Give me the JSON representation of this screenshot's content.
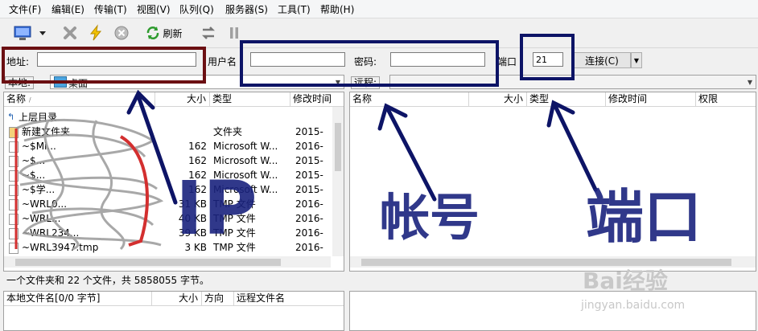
{
  "menu": [
    "文件(F)",
    "编辑(E)",
    "传输(T)",
    "视图(V)",
    "队列(Q)",
    "服务器(S)",
    "工具(T)",
    "帮助(H)"
  ],
  "toolbar": {
    "refresh_label": "刷新",
    "icons": [
      "site-manager-icon",
      "dropdown-arrow-icon",
      "disconnect-icon",
      "reconnect-icon",
      "cancel-icon",
      "refresh-icon",
      "compare-icon",
      "pause-icon"
    ]
  },
  "connection": {
    "host_label": "地址:",
    "host_value": "",
    "user_label": "用户名",
    "user_value": "",
    "pass_label": "密码:",
    "pass_value": "",
    "port_label": "端口",
    "port_value": "21",
    "connect_label": "连接(C)"
  },
  "local": {
    "path_label": "本地:",
    "path_value": "桌面",
    "columns": [
      "名称",
      "大小",
      "类型",
      "修改时间"
    ],
    "parent_dir": "上层目录",
    "rows": [
      {
        "name": "新建文件夹",
        "size": "",
        "type": "文件夹",
        "date": "2015-"
      },
      {
        "name": "~$Mi...",
        "size": "162",
        "type": "Microsoft W...",
        "date": "2016-"
      },
      {
        "name": "~$...",
        "size": "162",
        "type": "Microsoft W...",
        "date": "2015-"
      },
      {
        "name": "~$...",
        "size": "162",
        "type": "Microsoft W...",
        "date": "2015-"
      },
      {
        "name": "~$学...",
        "size": "162",
        "type": "Microsoft W...",
        "date": "2015-"
      },
      {
        "name": "~WRL0...",
        "size": "31 KB",
        "type": "TMP 文件",
        "date": "2016-"
      },
      {
        "name": "~WRL...",
        "size": "40 KB",
        "type": "TMP 文件",
        "date": "2016-"
      },
      {
        "name": "~WRL234...",
        "size": "39 KB",
        "type": "TMP 文件",
        "date": "2016-"
      },
      {
        "name": "~WRL3947.tmp",
        "size": "3 KB",
        "type": "TMP 文件",
        "date": "2016-"
      }
    ],
    "status": "一个文件夹和 22 个文件，共 5858055 字节。"
  },
  "remote": {
    "path_label": "远程:",
    "path_value": "",
    "columns": [
      "名称",
      "大小",
      "类型",
      "修改时间",
      "权限"
    ]
  },
  "queue": {
    "columns": [
      "本地文件名[0/0 字节]",
      "大小",
      "方向",
      "远程文件名"
    ]
  },
  "annotations": {
    "ip_text": "IP",
    "account_text": "帐号",
    "port_text": "端口"
  },
  "watermark": {
    "brand": "Bai经验",
    "url": "jingyan.baidu.com"
  },
  "colors": {
    "annotation_navy": "#0d1466",
    "annotation_maroon": "#6b0f12",
    "scribble_gray": "#9a9a9a",
    "scribble_red": "#d32f2f"
  }
}
